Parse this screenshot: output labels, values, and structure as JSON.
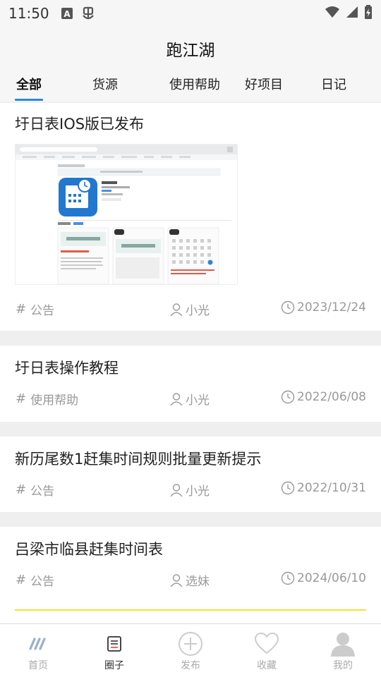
{
  "status_bar": {
    "time": "11:50"
  },
  "header": {
    "title": "跑江湖"
  },
  "tabs": [
    {
      "label": "全部",
      "active": true
    },
    {
      "label": "货源"
    },
    {
      "label": "使用帮助"
    },
    {
      "label": "好项目"
    },
    {
      "label": "日记"
    }
  ],
  "posts": [
    {
      "title": "圩日表IOS版已发布",
      "category": "公告",
      "author": "小光",
      "date": "2023/12/24",
      "has_image": true,
      "image_icon": "calendar-app-icon"
    },
    {
      "title": "圩日表操作教程",
      "category": "使用帮助",
      "author": "小光",
      "date": "2022/06/08"
    },
    {
      "title": "新历尾数1赶集时间规则批量更新提示",
      "category": "公告",
      "author": "小光",
      "date": "2022/10/31"
    },
    {
      "title": "吕梁市临县赶集时间表",
      "category": "公告",
      "author": "选妹",
      "date": "2024/06/10"
    }
  ],
  "bottom_nav": [
    {
      "label": "首页",
      "icon": "home-stripes-icon"
    },
    {
      "label": "圈子",
      "icon": "document-icon",
      "active": true
    },
    {
      "label": "发布",
      "icon": "plus-circle-icon"
    },
    {
      "label": "收藏",
      "icon": "heart-icon"
    },
    {
      "label": "我的",
      "icon": "user-avatar-icon"
    }
  ],
  "colors": {
    "accent": "#2a8ad8",
    "divider_highlight": "#f2e233",
    "meta_text": "#999999"
  }
}
